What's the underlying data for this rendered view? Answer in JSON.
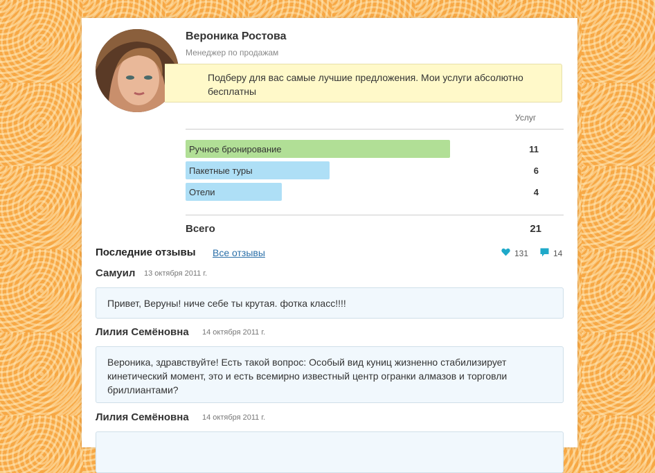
{
  "profile": {
    "name": "Вероника Ростова",
    "role": "Менеджер по продажам",
    "bio": "Подберу для вас самые лучшие предложения. Мои услуги абсолютно бесплатны"
  },
  "services": {
    "header": "Услуг",
    "items": [
      {
        "label": "Ручное бронирование",
        "count": "11",
        "value": 11,
        "color": "#b1df96"
      },
      {
        "label": "Пакетные туры",
        "count": "6",
        "value": 6,
        "color": "#aedff6"
      },
      {
        "label": "Отели",
        "count": "4",
        "value": 4,
        "color": "#aedff6"
      }
    ],
    "total_label": "Всего",
    "total_value": "21"
  },
  "reviews": {
    "title": "Последние отзывы",
    "all_link": "Все отзывы",
    "likes": "131",
    "comments": "14",
    "items": [
      {
        "author": "Самуил",
        "date": "13 октября 2011 г.",
        "text": "Привет, Веруны! ниче себе ты крутая. фотка класс!!!!"
      },
      {
        "author": "Лилия Семёновна",
        "date": "14 октября 2011 г.",
        "text": "Вероника, здравствуйте! Есть такой вопрос: Особый вид куниц жизненно стабилизирует кинетический момент, это и есть всемирно известный центр огранки алмазов и торговли бриллиантами?"
      },
      {
        "author": "Лилия Семёновна",
        "date": "14 октября 2011 г.",
        "text": ""
      }
    ]
  },
  "colors": {
    "background": "#f7a845",
    "bubble": "#fff9c9",
    "bar_green": "#b1df96",
    "bar_blue": "#aedff6",
    "icon_teal": "#1fa9c9",
    "link": "#2a6fa8"
  },
  "icons": {
    "likes": "heart-icon",
    "comments": "speech-bubble-icon"
  }
}
